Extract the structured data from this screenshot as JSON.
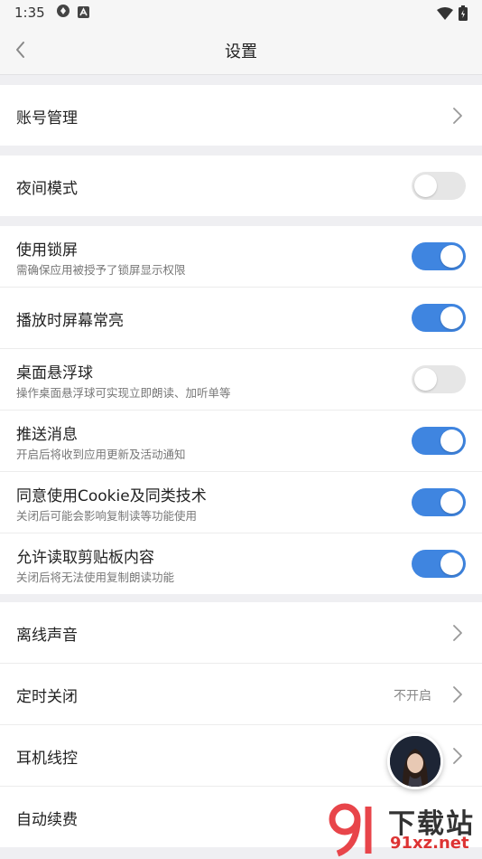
{
  "status_bar": {
    "time": "1:35"
  },
  "nav": {
    "title": "设置"
  },
  "account": {
    "label": "账号管理"
  },
  "night_mode": {
    "label": "夜间模式",
    "enabled": false
  },
  "toggles": [
    {
      "label": "使用锁屏",
      "sub": "需确保应用被授予了锁屏显示权限",
      "enabled": true
    },
    {
      "label": "播放时屏幕常亮",
      "sub": "",
      "enabled": true
    },
    {
      "label": "桌面悬浮球",
      "sub": "操作桌面悬浮球可实现立即朗读、加听单等",
      "enabled": false
    },
    {
      "label": "推送消息",
      "sub": "开启后将收到应用更新及活动通知",
      "enabled": true
    },
    {
      "label": "同意使用Cookie及同类技术",
      "sub": "关闭后可能会影响复制读等功能使用",
      "enabled": true
    },
    {
      "label": "允许读取剪贴板内容",
      "sub": "关闭后将无法使用复制朗读功能",
      "enabled": true
    }
  ],
  "more": [
    {
      "label": "离线声音",
      "value": ""
    },
    {
      "label": "定时关闭",
      "value": "不开启"
    },
    {
      "label": "耳机线控",
      "value": ""
    },
    {
      "label": "自动续费",
      "value": ""
    }
  ],
  "watermark": {
    "big": "下载站",
    "small": "91xz.net"
  },
  "colors": {
    "accent": "#3f85e0",
    "toggle_off": "#e6e6e6",
    "background": "#efeff2"
  }
}
